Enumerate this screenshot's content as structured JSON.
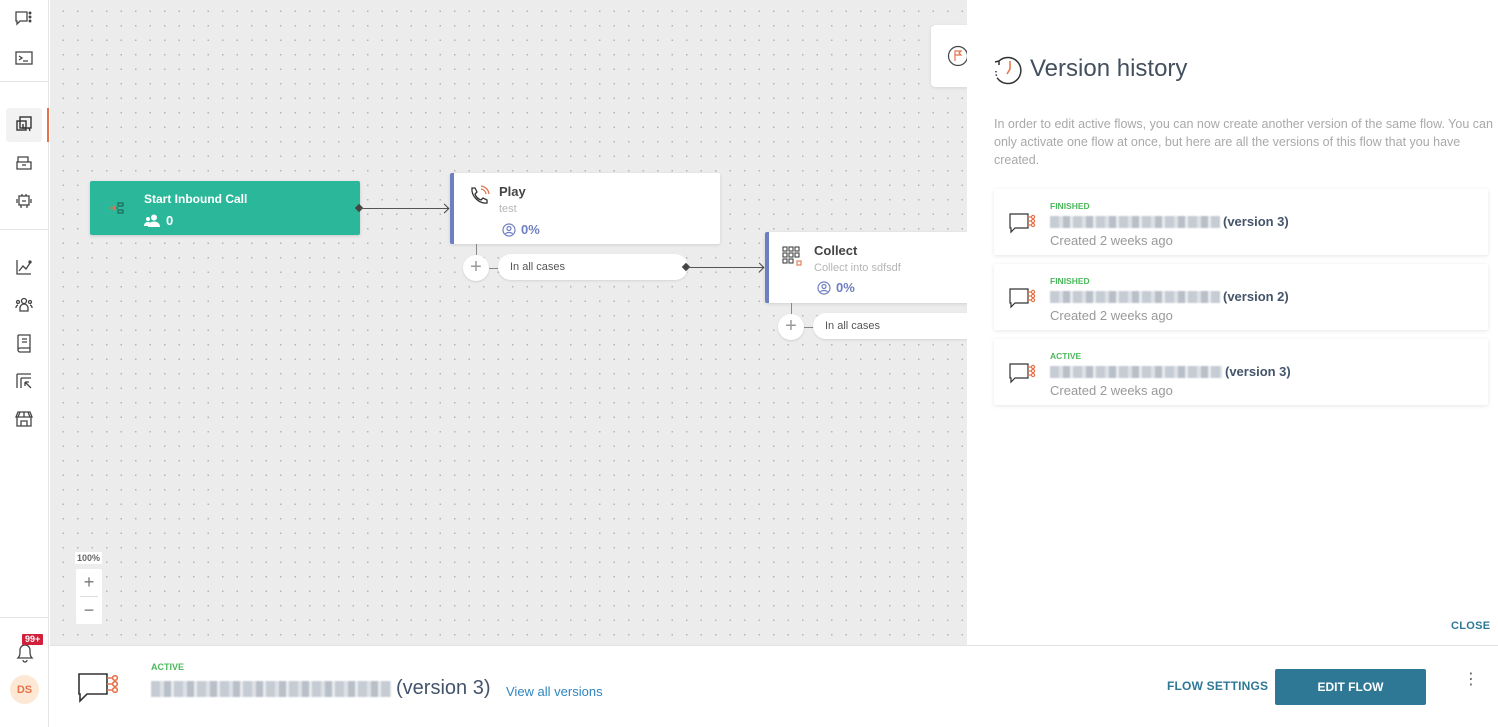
{
  "nav": {
    "items": [
      {
        "name": "conversations",
        "icon": "chat-dots-icon"
      },
      {
        "name": "terminal",
        "icon": "terminal-icon"
      },
      {
        "name": "flows",
        "icon": "flows-icon",
        "active": true
      },
      {
        "name": "inbox",
        "icon": "inbox-icon"
      },
      {
        "name": "bots",
        "icon": "robot-icon"
      },
      {
        "name": "analytics",
        "icon": "chart-line-icon"
      },
      {
        "name": "people",
        "icon": "people-icon"
      },
      {
        "name": "knowledge",
        "icon": "book-icon"
      },
      {
        "name": "import",
        "icon": "import-icon"
      },
      {
        "name": "store",
        "icon": "store-icon"
      }
    ],
    "notifications_badge": "99+",
    "avatar_initials": "DS"
  },
  "canvas": {
    "start_node": {
      "title": "Start Inbound Call",
      "count": "0"
    },
    "play_node": {
      "title": "Play",
      "subtitle": "test",
      "percent": "0%",
      "branch": "In all cases"
    },
    "collect_node": {
      "title": "Collect",
      "subtitle": "Collect into sdfsdf",
      "percent": "0%",
      "branch": "In all cases"
    },
    "zoom_level": "100%",
    "zoom_in": "+",
    "zoom_out": "−"
  },
  "panel": {
    "title": "Version history",
    "description": "In order to edit active flows, you can now create another version of the same flow. You can only activate one flow at once, but here are all the versions of this flow that you have created.",
    "versions": [
      {
        "status": "FINISHED",
        "version": "(version 3)",
        "created": "Created 2 weeks ago"
      },
      {
        "status": "FINISHED",
        "version": "(version 2)",
        "created": "Created 2 weeks ago"
      },
      {
        "status": "ACTIVE",
        "version": "(version 3)",
        "created": "Created 2 weeks ago"
      }
    ],
    "close_label": "CLOSE"
  },
  "bottom": {
    "status": "ACTIVE",
    "version": "(version 3)",
    "view_all": "View all versions",
    "flow_settings": "FLOW SETTINGS",
    "edit_flow": "EDIT FLOW",
    "more": "⋮"
  },
  "colors": {
    "accent": "#e5734a",
    "start_node": "#2bb89a",
    "node_border": "#6e7fc1",
    "primary_button": "#2e7896",
    "status_green": "#4cb85c"
  }
}
